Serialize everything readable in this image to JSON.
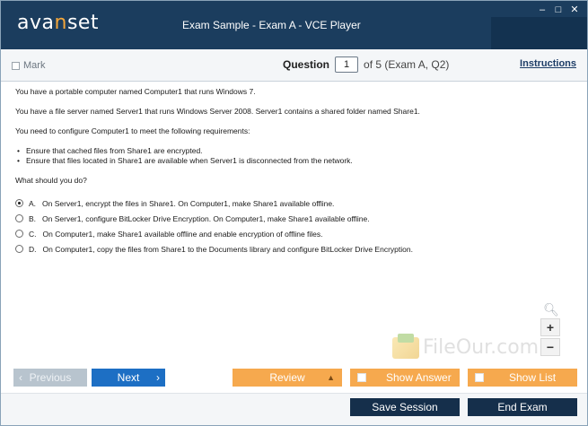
{
  "titlebar": {
    "logo_pre": "ava",
    "logo_accent": "n",
    "logo_post": "set",
    "title": "Exam Sample - Exam A - VCE Player",
    "minimize": "–",
    "maximize": "□",
    "close": "✕"
  },
  "question_bar": {
    "mark_label": "Mark",
    "question_label": "Question",
    "question_number": "1",
    "of_text": "of 5 (Exam A, Q2)",
    "instructions_label": "Instructions"
  },
  "question": {
    "paragraphs": [
      "You have a portable computer named Computer1 that runs Windows 7.",
      "You have a file server named Server1 that runs Windows Server 2008. Server1 contains a shared folder named Share1.",
      "You need to configure Computer1 to meet the following requirements:"
    ],
    "requirements": [
      "Ensure that cached files from Share1 are encrypted.",
      "Ensure that files located in Share1 are available when Server1 is disconnected from the network."
    ],
    "prompt": "What should you do?",
    "options": [
      {
        "letter": "A.",
        "text": "On Server1, encrypt the files in Share1. On Computer1, make Share1 available offline."
      },
      {
        "letter": "B.",
        "text": "On Server1, configure BitLocker Drive Encryption. On Computer1, make Share1 available offline."
      },
      {
        "letter": "C.",
        "text": "On Computer1, make Share1 available offline and enable encryption of offline files."
      },
      {
        "letter": "D.",
        "text": "On Computer1, copy the files from Share1 to the Documents library and configure BitLocker Drive Encryption."
      }
    ],
    "selected_option": "A."
  },
  "zoom": {
    "zoom_in": "+",
    "zoom_out": "−"
  },
  "watermark": {
    "text": "FileOur.com"
  },
  "buttons": {
    "previous": "Previous",
    "next": "Next",
    "review": "Review",
    "show_answer": "Show Answer",
    "show_list": "Show List",
    "save_session": "Save Session",
    "end_exam": "End Exam"
  },
  "colors": {
    "titlebar": "#1b3d5e",
    "logo_accent": "#f4a63a",
    "next_button": "#1d6fc4",
    "orange_buttons": "#f6a94e",
    "dark_buttons": "#152f4b"
  }
}
